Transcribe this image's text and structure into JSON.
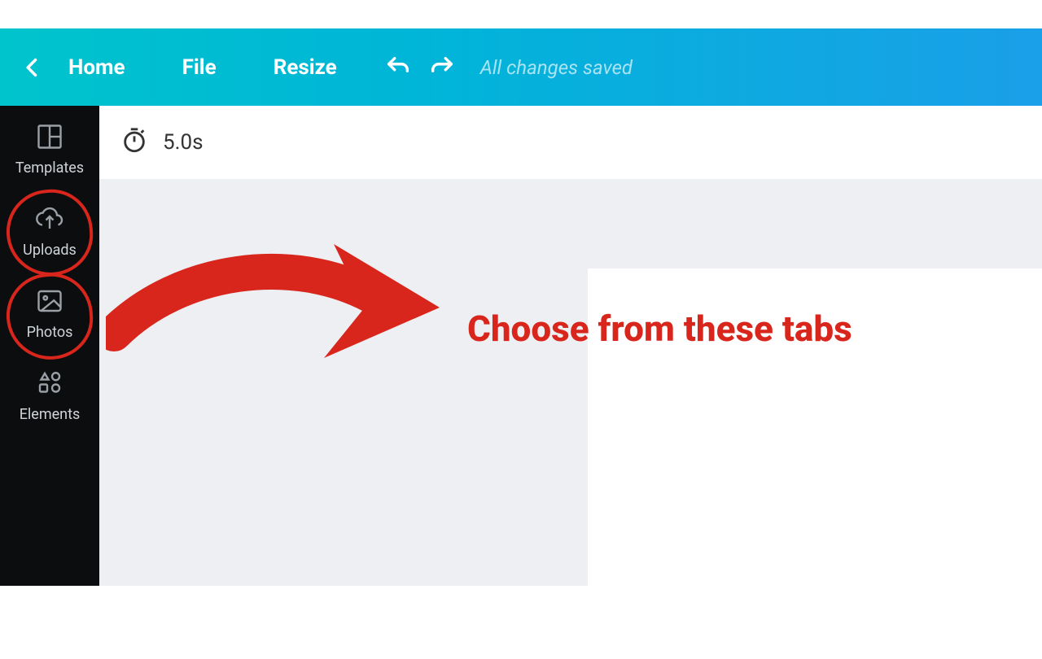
{
  "topbar": {
    "home_label": "Home",
    "file_label": "File",
    "resize_label": "Resize",
    "status_text": "All changes saved"
  },
  "sidebar": {
    "items": [
      {
        "label": "Templates",
        "icon": "templates"
      },
      {
        "label": "Uploads",
        "icon": "uploads"
      },
      {
        "label": "Photos",
        "icon": "photos"
      },
      {
        "label": "Elements",
        "icon": "elements"
      }
    ]
  },
  "page": {
    "duration_text": "5.0s"
  },
  "annotation": {
    "text": "Choose from these tabs"
  },
  "colors": {
    "accent_red": "#d9261c",
    "sidebar_bg": "#0b0d0f",
    "canvas_bg": "#edeff2"
  }
}
